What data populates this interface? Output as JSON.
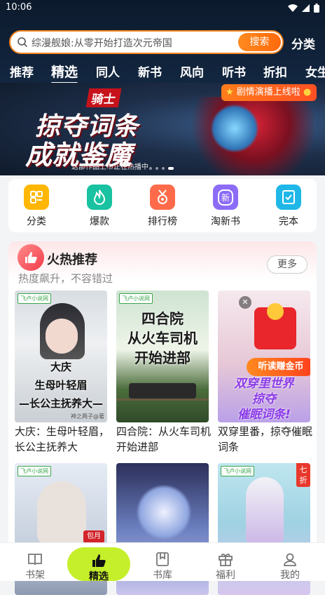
{
  "status": {
    "time": "10:06"
  },
  "search": {
    "placeholder": "综漫舰娘:从零开始打造次元帝国",
    "button": "搜索",
    "category": "分类"
  },
  "tabs": [
    "推荐",
    "精选",
    "同人",
    "新书",
    "风向",
    "听书",
    "折扣",
    "女生"
  ],
  "active_tab": "精选",
  "banner": {
    "badge": "骑士",
    "title_line1": "掠夺词条",
    "title_line2": "成就鉴魔",
    "subtitle": "这部作品上市正在热播中",
    "pill": "剧情演播上线啦",
    "page_count": 4,
    "current_page": 4
  },
  "quick": [
    {
      "label": "分类",
      "icon": "grid-icon",
      "color": "#ffb703"
    },
    {
      "label": "爆款",
      "icon": "flame-icon",
      "color": "#19c2a1"
    },
    {
      "label": "排行榜",
      "icon": "medal-icon",
      "color": "#ff6b4a"
    },
    {
      "label": "淘新书",
      "icon": "new-book-icon",
      "color": "#8c6cf6",
      "glyph": "新"
    },
    {
      "label": "完本",
      "icon": "check-book-icon",
      "color": "#1fb7e8"
    }
  ],
  "hot": {
    "title": "火热推荐",
    "subtitle": "热度飙升，不容错过",
    "more": "更多",
    "books": [
      {
        "title": "大庆：生母叶轻眉，长公主抚养大",
        "cover_text": "大庆\n生母叶轻眉\n—长公主抚养大—",
        "cover_author": "神之两子@著",
        "publisher": "飞卢小说网"
      },
      {
        "title": "四合院：从火车司机开始进部",
        "cover_text": "四合院\n从火车司机\n开始进部",
        "publisher": "飞卢小说网"
      },
      {
        "title": "双穿里番，掠夺催眠词条",
        "cover_text": "双穿里世界\n掠夺\n催眠词条!",
        "promo": "听读赚金币"
      },
      {
        "title": "",
        "publisher": "飞卢小说网",
        "tag": "包月"
      },
      {
        "title": "",
        "publisher": ""
      },
      {
        "title": "",
        "publisher": "飞卢小说网",
        "discount": "七折"
      }
    ]
  },
  "nav": [
    {
      "label": "书架",
      "icon": "bookshelf-icon"
    },
    {
      "label": "精选",
      "icon": "thumbs-up-icon"
    },
    {
      "label": "书库",
      "icon": "library-icon"
    },
    {
      "label": "福利",
      "icon": "gift-icon"
    },
    {
      "label": "我的",
      "icon": "profile-icon"
    }
  ]
}
